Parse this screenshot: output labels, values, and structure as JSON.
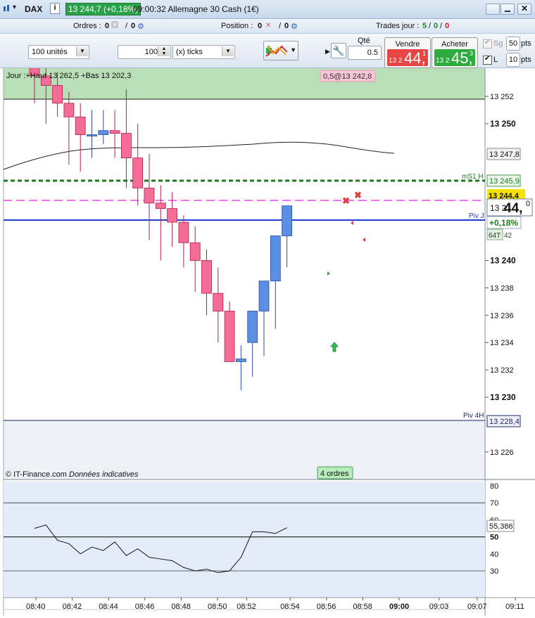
{
  "title_bar": {
    "instrument": "DAX",
    "info_icon": "i",
    "quote": "13 244,7 (+0,18%)",
    "time_name": "09:00:32 Allemagne 30 Cash (1€)"
  },
  "info_strip": {
    "orders_label": "Ordres :",
    "orders_count": "0",
    "orders_count2": "0",
    "position_label": "Position :",
    "position_count": "0",
    "position_count2": "0",
    "trades_label": "Trades jour :",
    "trades_total": "5",
    "trades_a": "0",
    "trades_b": "0"
  },
  "toolbar": {
    "units_select": "100 unités",
    "quantity_value": "100",
    "ticks_select": "(x) ticks",
    "qty_label": "Qté",
    "qty_value": "0.5",
    "sell_label": "Vendre",
    "sell_small": "13 2",
    "sell_big": "44,",
    "sell_sup": "1",
    "buy_label": "Acheter",
    "buy_small": "13 2",
    "buy_big": "45,",
    "buy_sup": "3",
    "sg_label": "Sg",
    "sg_value": "50",
    "l_label": "L",
    "l_value": "10",
    "pts_label": "pts",
    "pts_label2": "pts"
  },
  "chart": {
    "session_text": "Jour :+Haut 13 262,5 +Bas 13 202,3",
    "order_tag": "0,5@13 242,8",
    "copyright": "© IT-Finance.com",
    "disclaimer": "Données indicatives",
    "orders_badge": "4 ordres",
    "mS1_label": "mS1 H",
    "pivj_label": "Piv J",
    "piv4h_label": "Piv 4H",
    "price_current_small": "13 2",
    "price_current_big": "44,",
    "price_current_sup": "0",
    "change_badge": "+0,18%",
    "timer_badge": "64T",
    "tick_suffix": "42",
    "yellow_price": "13 244,4",
    "tags": {
      "ma": "13 247,8",
      "ms1": "13 245,9",
      "piv4h": "13 228,4",
      "osc": "55,386"
    },
    "price_axis": [
      "13 252",
      "13 250",
      "13 248",
      "13 246",
      "13 244",
      "13 242",
      "13 240",
      "13 238",
      "13 236",
      "13 234",
      "13 232",
      "13 230",
      "13 228",
      "13 226"
    ],
    "osc_axis": [
      "80",
      "70",
      "60",
      "50",
      "40",
      "30"
    ],
    "time_axis": [
      "08:40",
      "08:42",
      "08:44",
      "08:46",
      "08:48",
      "08:50",
      "08:52",
      "08:54",
      "08:56",
      "08:58",
      "09:00",
      "09:03",
      "09:07",
      "09:11"
    ],
    "colors": {
      "up": "#5b8fe6",
      "down": "#f46d97",
      "green_zone": "#b9dfb9",
      "ms1": "#1f7a1f",
      "pivot_dash": "#ee44ee",
      "pivj": "#1f3fd0"
    }
  },
  "chart_data": [
    {
      "type": "candlestick",
      "x": [
        "08:38",
        "08:39",
        "08:40",
        "08:41",
        "08:42",
        "08:43",
        "08:44",
        "08:45",
        "08:46",
        "08:47",
        "08:48",
        "08:49",
        "08:50",
        "08:51",
        "08:52",
        "08:53",
        "08:54",
        "08:55",
        "08:56",
        "08:57",
        "08:58",
        "08:59",
        "09:00"
      ],
      "open": [
        13254.5,
        13253.5,
        13252.8,
        13251.5,
        13250.5,
        13249.2,
        13249.2,
        13249.5,
        13249.3,
        13247.5,
        13245.3,
        13244.2,
        13243.8,
        13242.8,
        13241.3,
        13240.0,
        13237.6,
        13236.3,
        13232.6,
        13234.0,
        13236.3,
        13238.5,
        13241.8
      ],
      "high": [
        13256.0,
        13255.0,
        13253.8,
        13252.3,
        13251.5,
        13251.0,
        13251.0,
        13251.0,
        13252.5,
        13250.0,
        13247.8,
        13245.5,
        13245.0,
        13243.3,
        13242.5,
        13240.8,
        13239.5,
        13237.0,
        13233.8,
        13235.0,
        13238.0,
        13240.5,
        13243.5
      ],
      "low": [
        13251.5,
        13250.0,
        13250.5,
        13247.0,
        13246.5,
        13247.5,
        13248.5,
        13247.5,
        13245.3,
        13244.0,
        13241.5,
        13240.0,
        13241.0,
        13239.5,
        13237.7,
        13236.0,
        13234.0,
        13234.5,
        13230.5,
        13231.5,
        13233.0,
        13235.0,
        13239.5
      ],
      "close": [
        13253.5,
        13252.8,
        13251.5,
        13250.5,
        13249.2,
        13249.2,
        13249.5,
        13249.3,
        13247.5,
        13245.3,
        13244.2,
        13243.8,
        13242.8,
        13241.3,
        13240.0,
        13237.6,
        13236.3,
        13232.6,
        13232.8,
        13236.3,
        13238.5,
        13241.8,
        13244.0
      ]
    },
    {
      "type": "line",
      "ylim": [
        25,
        85
      ],
      "x": [
        "08:38",
        "08:39",
        "08:40",
        "08:41",
        "08:42",
        "08:43",
        "08:44",
        "08:45",
        "08:46",
        "08:47",
        "08:48",
        "08:49",
        "08:50",
        "08:51",
        "08:52",
        "08:53",
        "08:54",
        "08:55",
        "08:56",
        "08:57",
        "08:58",
        "08:59",
        "09:00"
      ],
      "values": [
        55,
        57,
        48,
        46,
        40,
        44,
        42,
        47,
        39,
        43,
        38,
        37,
        36,
        32,
        30,
        31,
        29,
        30,
        38,
        53,
        53,
        52,
        55.4
      ]
    }
  ]
}
